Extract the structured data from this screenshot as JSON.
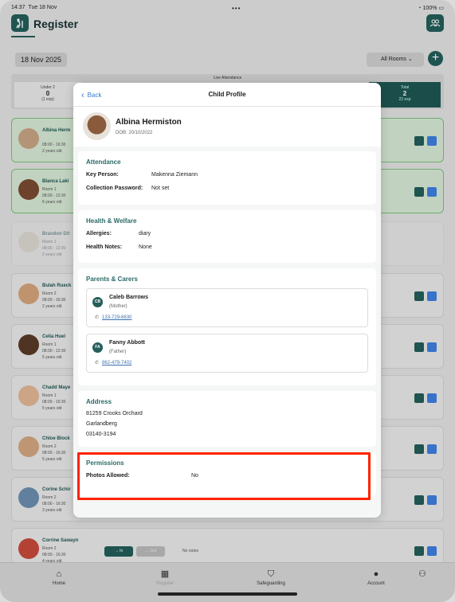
{
  "status_bar": {
    "time": "14:37",
    "date": "Tue 18 Nov",
    "battery": "100%"
  },
  "header": {
    "title": "Register"
  },
  "toolbar": {
    "date": "18 Nov 2025",
    "rooms": "All Rooms"
  },
  "live_attendance": {
    "label": "Live Attendance",
    "left_label": "Under 2",
    "left_value": "0",
    "left_sub": "(1 exp)",
    "right_label": "Total",
    "right_value": "2",
    "right_sub": "22 exp"
  },
  "cards": [
    {
      "name": "Albina Herm",
      "room": "",
      "time": "08:00 - 16:30",
      "age": "2 years old"
    },
    {
      "name": "Blanca Laki",
      "room": "Room 1",
      "time": "08:00 - 12:30",
      "age": "6 years old"
    },
    {
      "name": "Brandon Dit",
      "room": "Room 1",
      "time": "08:00 - 12:30",
      "age": "2 years old"
    },
    {
      "name": "Bulah Rueck",
      "room": "Room 2",
      "time": "08:00 - 16:30",
      "age": "2 years old"
    },
    {
      "name": "Celia Huel",
      "room": "Room 1",
      "time": "08:00 - 12:30",
      "age": "5 years old"
    },
    {
      "name": "Chadd Maye",
      "room": "Room 1",
      "time": "08:00 - 16:30",
      "age": "5 years old"
    },
    {
      "name": "Chloe Block",
      "room": "Room 2",
      "time": "08:00 - 16:30",
      "age": "5 years old"
    },
    {
      "name": "Corine Schir",
      "room": "Room 2",
      "time": "08:00 - 16:30",
      "age": "3 years old"
    },
    {
      "name": "Corrine Sawayn",
      "room": "Room 2",
      "time": "08:00 - 16:30",
      "age": "4 years old",
      "in_label": "→ In",
      "out_label": "← Out",
      "notes": "No notes"
    }
  ],
  "tabs": [
    {
      "label": "Home",
      "icon": "house-icon"
    },
    {
      "label": "Register",
      "icon": "calendar-icon"
    },
    {
      "label": "Safeguarding",
      "icon": "shield-icon"
    },
    {
      "label": "Account",
      "icon": "person-icon"
    }
  ],
  "modal": {
    "back_label": "Back",
    "title": "Child Profile",
    "child_name": "Albina Hermiston",
    "dob": "DOB: 20/10/2022",
    "attendance": {
      "heading": "Attendance",
      "key_person_label": "Key Person:",
      "key_person_value": "Makenna Ziemann",
      "collection_label": "Collection Password:",
      "collection_value": "Not set"
    },
    "health": {
      "heading": "Health & Welfare",
      "allergies_label": "Allergies:",
      "allergies_value": "diary",
      "notes_label": "Health Notes:",
      "notes_value": "None"
    },
    "parents": {
      "heading": "Parents & Carers",
      "carers": [
        {
          "initials": "CB",
          "name": "Caleb Barrows",
          "relation": "(Mother)",
          "phone": "133-729-6630"
        },
        {
          "initials": "FA",
          "name": "Fanny Abbott",
          "relation": "(Father)",
          "phone": "862-479-7402"
        }
      ]
    },
    "address": {
      "heading": "Address",
      "line1": "81259 Crooks Orchard",
      "line2": "Garlandberg",
      "line3": "03140-3194"
    },
    "permissions": {
      "heading": "Permissions",
      "photos_label": "Photos Allowed:",
      "photos_value": "No"
    }
  },
  "colors": {
    "brand": "#235e5a",
    "heading": "#2a6b67",
    "link": "#3b7bd6",
    "highlight": "#ff2200"
  }
}
